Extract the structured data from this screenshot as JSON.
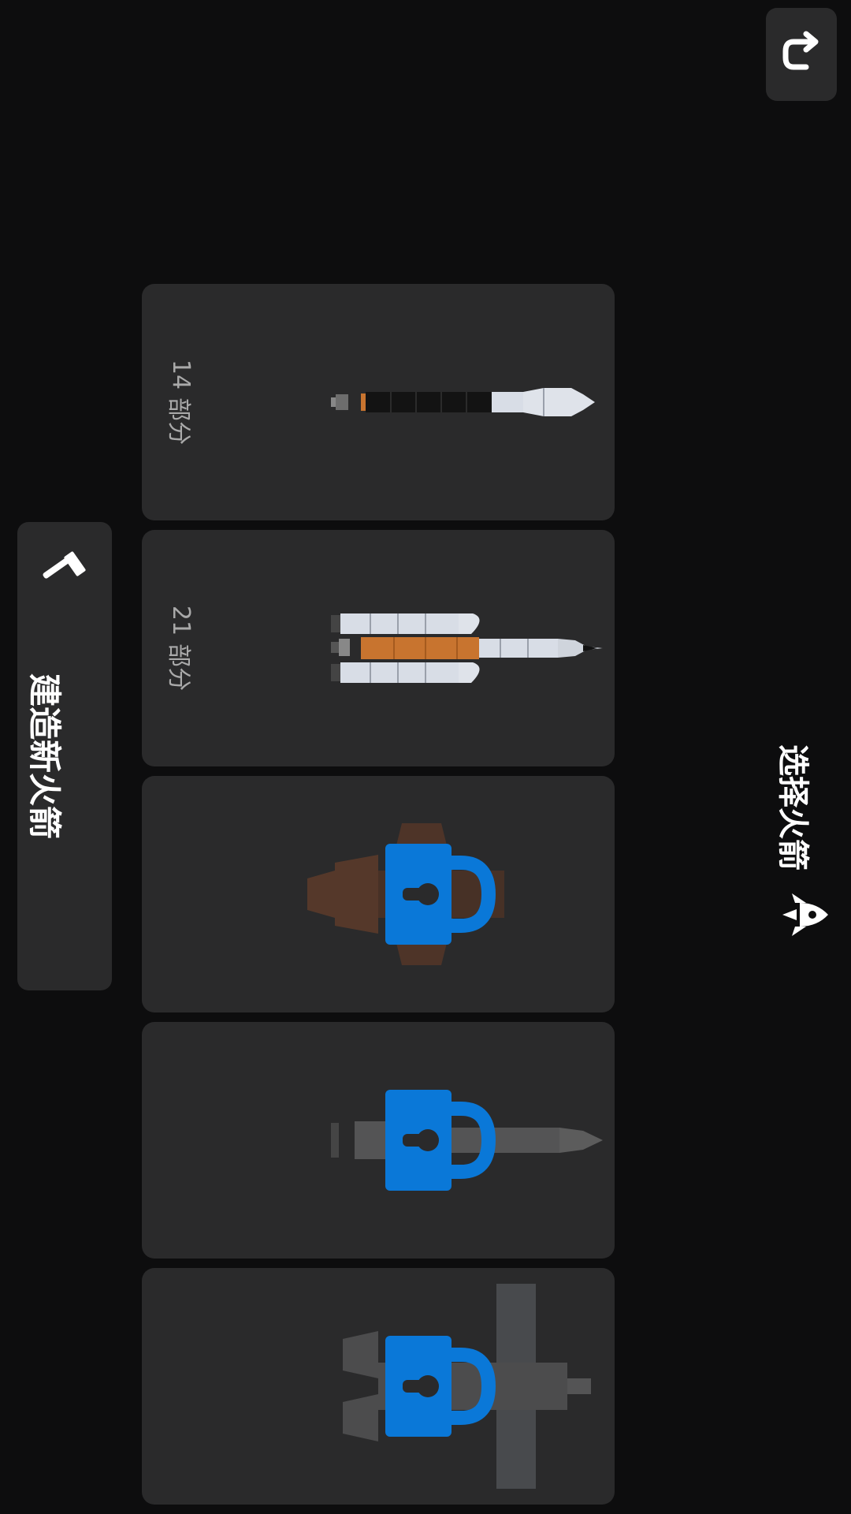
{
  "header": {
    "title": "选择火箭",
    "undo_icon": "undo-icon",
    "rocket_icon": "rocket-icon"
  },
  "build_button": {
    "label": "建造新火箭",
    "icon": "hammer-icon"
  },
  "rockets": [
    {
      "parts_count": "14",
      "parts_unit": "部分",
      "locked": false
    },
    {
      "parts_count": "21",
      "parts_unit": "部分",
      "locked": false
    },
    {
      "parts_count": "",
      "parts_unit": "",
      "locked": true
    },
    {
      "parts_count": "",
      "parts_unit": "",
      "locked": true
    },
    {
      "parts_count": "",
      "parts_unit": "",
      "locked": true
    }
  ],
  "colors": {
    "background": "#0d0d0e",
    "card": "#2a2a2b",
    "lock": "#0a78d8",
    "booster_orange": "#c8742f"
  }
}
